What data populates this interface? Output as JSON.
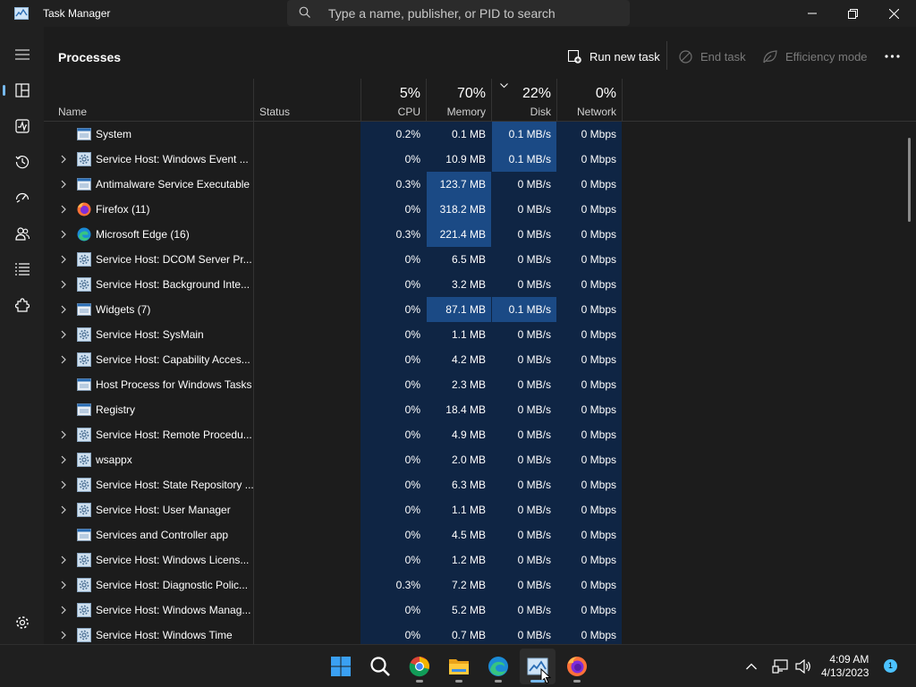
{
  "titlebar": {
    "app_title": "Task Manager",
    "search_placeholder": "Type a name, publisher, or PID to search"
  },
  "page": {
    "title": "Processes"
  },
  "toolbar": {
    "run_new_task": "Run new task",
    "end_task": "End task",
    "efficiency_mode": "Efficiency mode"
  },
  "columns": {
    "name": "Name",
    "status": "Status",
    "cpu_pct": "5%",
    "cpu": "CPU",
    "memory_pct": "70%",
    "memory": "Memory",
    "disk_pct": "22%",
    "disk": "Disk",
    "network_pct": "0%",
    "network": "Network"
  },
  "processes": [
    {
      "name": "System",
      "expandable": false,
      "icon": "window-icon",
      "cpu": "0.2%",
      "memory": "0.1 MB",
      "disk": "0.1 MB/s",
      "network": "0 Mbps"
    },
    {
      "name": "Service Host: Windows Event ...",
      "expandable": true,
      "icon": "gear-icon",
      "cpu": "0%",
      "memory": "10.9 MB",
      "disk": "0.1 MB/s",
      "network": "0 Mbps"
    },
    {
      "name": "Antimalware Service Executable",
      "expandable": true,
      "icon": "window-icon",
      "cpu": "0.3%",
      "memory": "123.7 MB",
      "disk": "0 MB/s",
      "network": "0 Mbps"
    },
    {
      "name": "Firefox (11)",
      "expandable": true,
      "icon": "firefox-icon",
      "cpu": "0%",
      "memory": "318.2 MB",
      "disk": "0 MB/s",
      "network": "0 Mbps"
    },
    {
      "name": "Microsoft Edge (16)",
      "expandable": true,
      "icon": "edge-icon",
      "cpu": "0.3%",
      "memory": "221.4 MB",
      "disk": "0 MB/s",
      "network": "0 Mbps"
    },
    {
      "name": "Service Host: DCOM Server Pr...",
      "expandable": true,
      "icon": "gear-icon",
      "cpu": "0%",
      "memory": "6.5 MB",
      "disk": "0 MB/s",
      "network": "0 Mbps"
    },
    {
      "name": "Service Host: Background Inte...",
      "expandable": true,
      "icon": "gear-icon",
      "cpu": "0%",
      "memory": "3.2 MB",
      "disk": "0 MB/s",
      "network": "0 Mbps"
    },
    {
      "name": "Widgets (7)",
      "expandable": true,
      "icon": "window-icon",
      "cpu": "0%",
      "memory": "87.1 MB",
      "disk": "0.1 MB/s",
      "network": "0 Mbps"
    },
    {
      "name": "Service Host: SysMain",
      "expandable": true,
      "icon": "gear-icon",
      "cpu": "0%",
      "memory": "1.1 MB",
      "disk": "0 MB/s",
      "network": "0 Mbps"
    },
    {
      "name": "Service Host: Capability Acces...",
      "expandable": true,
      "icon": "gear-icon",
      "cpu": "0%",
      "memory": "4.2 MB",
      "disk": "0 MB/s",
      "network": "0 Mbps"
    },
    {
      "name": "Host Process for Windows Tasks",
      "expandable": false,
      "icon": "window-icon",
      "cpu": "0%",
      "memory": "2.3 MB",
      "disk": "0 MB/s",
      "network": "0 Mbps"
    },
    {
      "name": "Registry",
      "expandable": false,
      "icon": "window-icon",
      "cpu": "0%",
      "memory": "18.4 MB",
      "disk": "0 MB/s",
      "network": "0 Mbps"
    },
    {
      "name": "Service Host: Remote Procedu...",
      "expandable": true,
      "icon": "gear-icon",
      "cpu": "0%",
      "memory": "4.9 MB",
      "disk": "0 MB/s",
      "network": "0 Mbps"
    },
    {
      "name": "wsappx",
      "expandable": true,
      "icon": "gear-icon",
      "cpu": "0%",
      "memory": "2.0 MB",
      "disk": "0 MB/s",
      "network": "0 Mbps"
    },
    {
      "name": "Service Host: State Repository ...",
      "expandable": true,
      "icon": "gear-icon",
      "cpu": "0%",
      "memory": "6.3 MB",
      "disk": "0 MB/s",
      "network": "0 Mbps"
    },
    {
      "name": "Service Host: User Manager",
      "expandable": true,
      "icon": "gear-icon",
      "cpu": "0%",
      "memory": "1.1 MB",
      "disk": "0 MB/s",
      "network": "0 Mbps"
    },
    {
      "name": "Services and Controller app",
      "expandable": false,
      "icon": "window-icon",
      "cpu": "0%",
      "memory": "4.5 MB",
      "disk": "0 MB/s",
      "network": "0 Mbps"
    },
    {
      "name": "Service Host: Windows Licens...",
      "expandable": true,
      "icon": "gear-icon",
      "cpu": "0%",
      "memory": "1.2 MB",
      "disk": "0 MB/s",
      "network": "0 Mbps"
    },
    {
      "name": "Service Host: Diagnostic Polic...",
      "expandable": true,
      "icon": "gear-icon",
      "cpu": "0.3%",
      "memory": "7.2 MB",
      "disk": "0 MB/s",
      "network": "0 Mbps"
    },
    {
      "name": "Service Host: Windows Manag...",
      "expandable": true,
      "icon": "gear-icon",
      "cpu": "0%",
      "memory": "5.2 MB",
      "disk": "0 MB/s",
      "network": "0 Mbps"
    },
    {
      "name": "Service Host: Windows Time",
      "expandable": true,
      "icon": "gear-icon",
      "cpu": "0%",
      "memory": "0.7 MB",
      "disk": "0 MB/s",
      "network": "0 Mbps"
    }
  ],
  "highlights": {
    "memory_rows": [
      2,
      3,
      4,
      7
    ],
    "disk_rows": [
      0,
      1,
      7
    ],
    "accent": "#1b4a85"
  },
  "taskbar": {
    "apps": [
      "windows-start-icon",
      "search-icon",
      "chrome-icon",
      "file-explorer-icon",
      "edge-icon",
      "task-manager-icon",
      "firefox-icon"
    ],
    "time": "4:09 AM",
    "date": "4/13/2023",
    "notification_count": "1"
  }
}
